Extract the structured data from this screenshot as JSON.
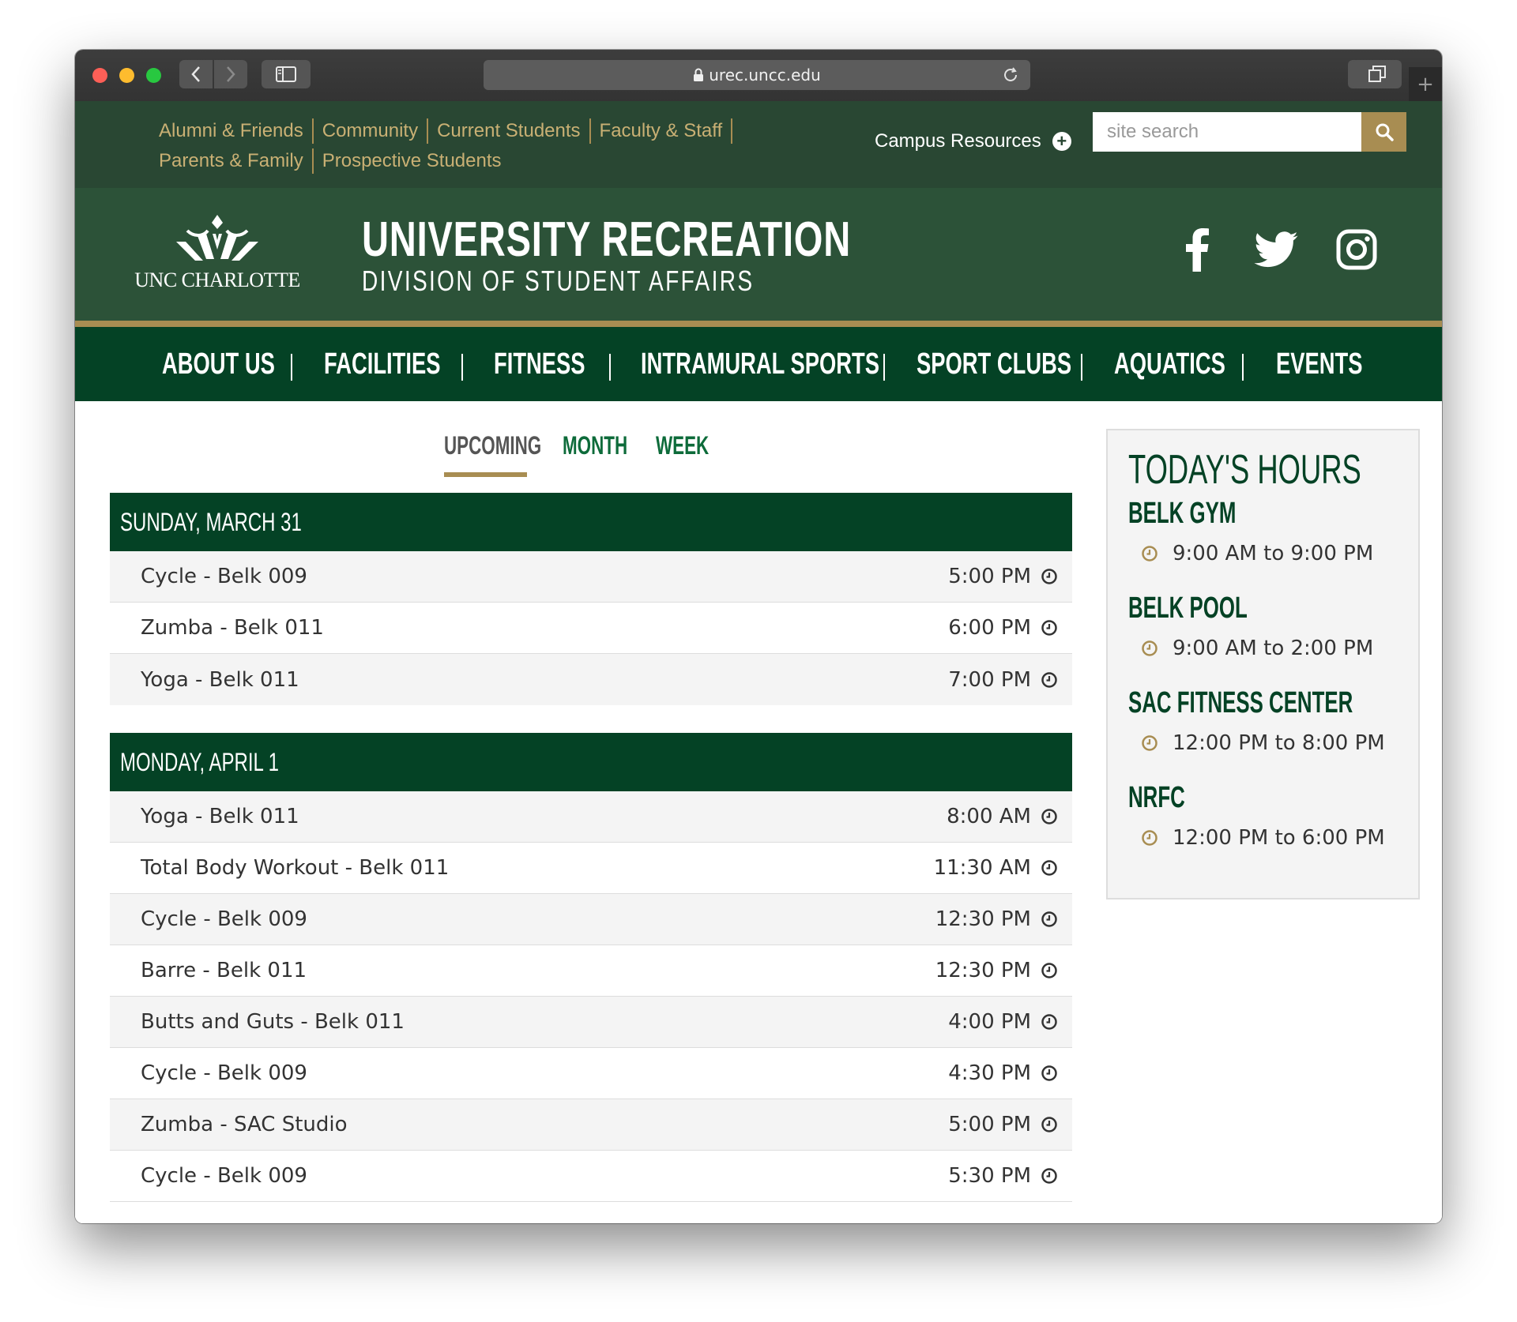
{
  "browser": {
    "url": "urec.uncc.edu"
  },
  "utility": {
    "links_row1": [
      "Alumni & Friends",
      "Community",
      "Current Students",
      "Faculty & Staff"
    ],
    "links_row2": [
      "Parents & Family",
      "Prospective Students"
    ],
    "campus_resources": "Campus Resources",
    "search_placeholder": "site search"
  },
  "banner": {
    "logo_text": "UNC CHARLOTTE",
    "title": "UNIVERSITY RECREATION",
    "subtitle": "DIVISION OF STUDENT AFFAIRS",
    "social_icons": [
      "facebook-icon",
      "twitter-icon",
      "instagram-icon"
    ]
  },
  "nav": {
    "items": [
      "ABOUT US",
      "FACILITIES",
      "FITNESS",
      "INTRAMURAL SPORTS",
      "SPORT CLUBS",
      "AQUATICS",
      "EVENTS"
    ]
  },
  "views": {
    "tabs": [
      "UPCOMING",
      "MONTH",
      "WEEK"
    ],
    "active": "UPCOMING"
  },
  "schedule": [
    {
      "day": "SUNDAY, MARCH 31",
      "events": [
        {
          "name": "Cycle - Belk 009",
          "time": "5:00 PM"
        },
        {
          "name": "Zumba - Belk 011",
          "time": "6:00 PM"
        },
        {
          "name": "Yoga - Belk 011",
          "time": "7:00 PM"
        }
      ]
    },
    {
      "day": "MONDAY, APRIL 1",
      "events": [
        {
          "name": "Yoga - Belk 011",
          "time": "8:00 AM"
        },
        {
          "name": "Total Body Workout - Belk 011",
          "time": "11:30 AM"
        },
        {
          "name": "Cycle - Belk 009",
          "time": "12:30 PM"
        },
        {
          "name": "Barre - Belk 011",
          "time": "12:30 PM"
        },
        {
          "name": "Butts and Guts - Belk 011",
          "time": "4:00 PM"
        },
        {
          "name": "Cycle - Belk 009",
          "time": "4:30 PM"
        },
        {
          "name": "Zumba - SAC Studio",
          "time": "5:00 PM"
        },
        {
          "name": "Cycle - Belk 009",
          "time": "5:30 PM"
        }
      ]
    }
  ],
  "hours": {
    "title": "TODAY'S HOURS",
    "facilities": [
      {
        "name": "BELK GYM",
        "hours": "9:00 AM to 9:00 PM"
      },
      {
        "name": "BELK POOL",
        "hours": "9:00 AM to 2:00 PM"
      },
      {
        "name": "SAC FITNESS CENTER",
        "hours": "12:00 PM to 8:00 PM"
      },
      {
        "name": "NRFC",
        "hours": "12:00 PM to 6:00 PM"
      }
    ]
  },
  "colors": {
    "dark_green": "#044225",
    "utility_green": "#294733",
    "banner_green": "#2c5238",
    "gold": "#a88d52",
    "link_green": "#0d6b3a"
  }
}
